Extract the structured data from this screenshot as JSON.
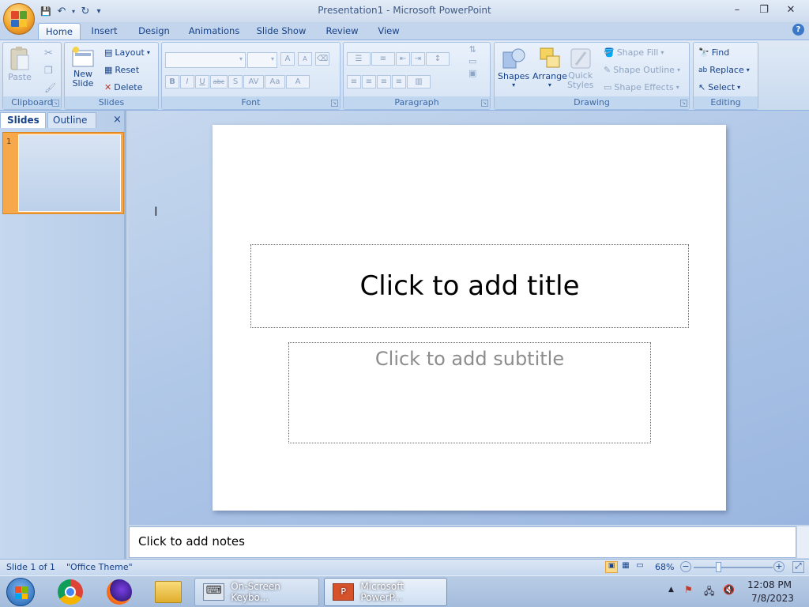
{
  "window": {
    "title": "Presentation1 - Microsoft PowerPoint",
    "minimize": "–",
    "maximize": "❐",
    "close": "✕"
  },
  "quick_access": {
    "save": "💾",
    "undo": "↶",
    "redo": "↻",
    "customize": "▾"
  },
  "tabs": [
    "Home",
    "Insert",
    "Design",
    "Animations",
    "Slide Show",
    "Review",
    "View"
  ],
  "active_tab": "Home",
  "help": "?",
  "ribbon": {
    "clipboard": {
      "label": "Clipboard",
      "paste": "Paste"
    },
    "slides": {
      "label": "Slides",
      "new_slide_line1": "New",
      "new_slide_line2": "Slide",
      "layout": "Layout",
      "reset": "Reset",
      "delete": "Delete"
    },
    "font": {
      "label": "Font",
      "bold": "B",
      "italic": "I",
      "underline": "U",
      "strike": "abc",
      "shadow": "S",
      "spacing": "AV",
      "case": "Aa",
      "color": "A",
      "grow": "A",
      "shrink": "A"
    },
    "paragraph": {
      "label": "Paragraph"
    },
    "drawing": {
      "label": "Drawing",
      "shapes": "Shapes",
      "arrange": "Arrange",
      "quick_styles_line1": "Quick",
      "quick_styles_line2": "Styles",
      "shape_fill": "Shape Fill",
      "shape_outline": "Shape Outline",
      "shape_effects": "Shape Effects"
    },
    "editing": {
      "label": "Editing",
      "find": "Find",
      "replace": "Replace",
      "select": "Select"
    }
  },
  "pane": {
    "tab_slides": "Slides",
    "tab_outline": "Outline",
    "close": "×",
    "slide_number": "1"
  },
  "slide": {
    "title_placeholder": "Click to add title",
    "subtitle_placeholder": "Click to add subtitle"
  },
  "notes": {
    "placeholder": "Click to add notes"
  },
  "status": {
    "slide_info": "Slide 1 of 1",
    "theme": "\"Office Theme\"",
    "zoom": "68%",
    "zoom_out": "−",
    "zoom_in": "+"
  },
  "taskbar": {
    "keyboard": "On-Screen Keybo...",
    "powerpoint": "Microsoft PowerP...",
    "time": "12:08 PM",
    "date": "7/8/2023"
  },
  "colors": {
    "ribbon_accent": "#15428b",
    "thumb_selected": "#f7a84a"
  }
}
